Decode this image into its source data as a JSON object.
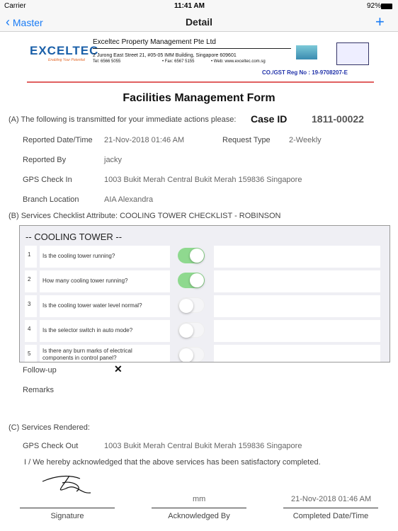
{
  "status": {
    "carrier": "Carrier",
    "time": "11:41 AM",
    "battery": "92%"
  },
  "nav": {
    "back": "Master",
    "title": "Detail",
    "add_icon": "plus-icon",
    "accent": "#1a7cf5"
  },
  "letterhead": {
    "logo": "EXCELTEC",
    "tagline": "Enabling Your Potential",
    "company": "Exceltec Property Management Pte Ltd",
    "address": "2 Jurong East Street 21, #05-05 IMM Building, Singapore 609601",
    "tel": "Tel: 6566 5055",
    "fax": "• Fax: 6567 5155",
    "web": "• Web: www.exceltec.com.sg",
    "reg": "CO./GST Reg No : 19-9708207-E"
  },
  "form": {
    "title": "Facilities Management Form",
    "section_a": "(A) The following is transmitted for your immediate actions please:",
    "case_id_label": "Case ID",
    "case_id": "1811-00022",
    "reported_dt_label": "Reported Date/Time",
    "reported_dt": "21-Nov-2018 01:46 AM",
    "request_type_label": "Request Type",
    "request_type": "2-Weekly",
    "reported_by_label": "Reported By",
    "reported_by": "jacky",
    "gps_in_label": "GPS Check In",
    "gps_in": "1003 Bukit Merah Central Bukit Merah 159836 Singapore",
    "branch_label": "Branch Location",
    "branch": "AIA Alexandra",
    "section_b": "(B) Services Checklist Attribute: COOLING TOWER CHECKLIST - ROBINSON",
    "checklist_header": "-- COOLING TOWER --",
    "items": [
      {
        "no": "1",
        "q": "Is the cooling tower running?",
        "on": true
      },
      {
        "no": "2",
        "q": "How many cooling tower running?",
        "on": true
      },
      {
        "no": "3",
        "q": "Is the cooling tower water level normal?",
        "on": false
      },
      {
        "no": "4",
        "q": "Is the selector switch in auto mode?",
        "on": false
      },
      {
        "no": "5",
        "q": "Is there any burn marks of electrical components in control panel?",
        "on": false
      }
    ],
    "followup_label": "Follow-up",
    "followup_value": "✕",
    "remarks_label": "Remarks",
    "section_c": "(C) Services Rendered:",
    "gps_out_label": "GPS Check Out",
    "gps_out": "1003 Bukit Merah Central Bukit Merah 159836 Singapore",
    "ack_text": "I / We hereby acknowledged that the above services has been satisfactory completed.",
    "ack_by_value": "mm",
    "completed_value": "21-Nov-2018 01:46 AM",
    "sig_label": "Signature",
    "ack_by_label": "Acknowledged By",
    "completed_label": "Completed Date/Time"
  }
}
